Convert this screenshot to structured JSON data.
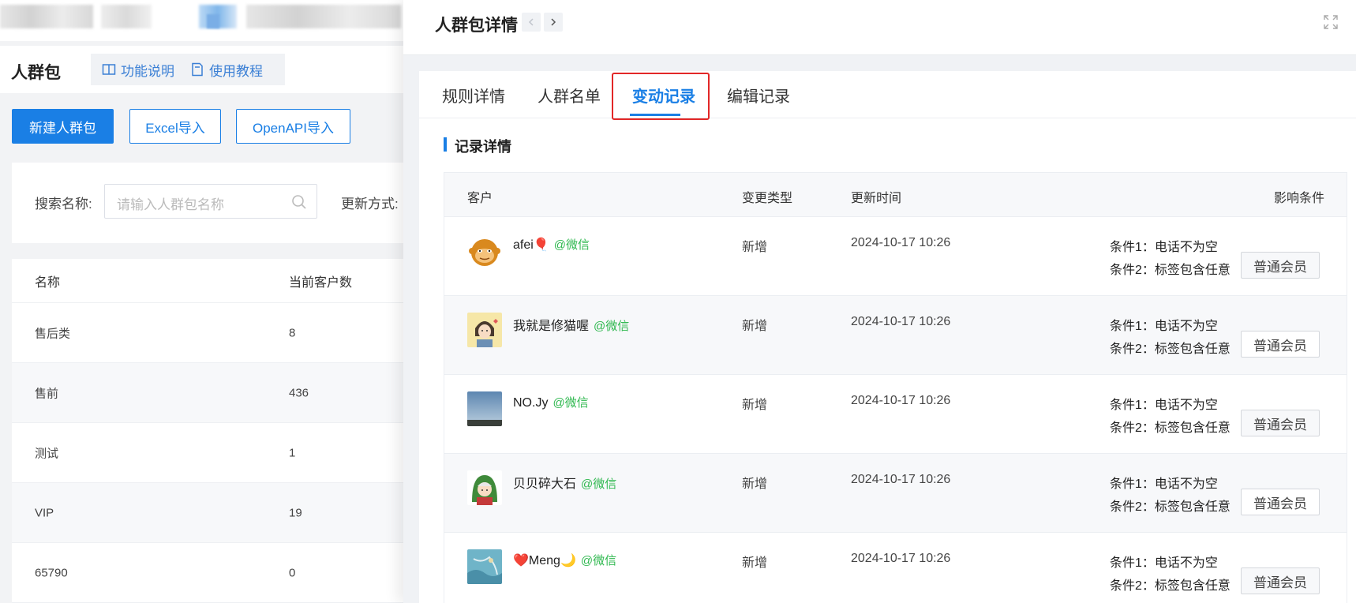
{
  "background": {
    "page_title": "人群包",
    "help_links": [
      "功能说明",
      "使用教程"
    ],
    "buttons": {
      "create": "新建人群包",
      "excel": "Excel导入",
      "openapi": "OpenAPI导入"
    },
    "search": {
      "label": "搜索名称:",
      "placeholder": "请输入人群包名称",
      "update_label": "更新方式:"
    },
    "table": {
      "headers": [
        "名称",
        "当前客户数"
      ],
      "rows": [
        {
          "name": "售后类",
          "count": "8"
        },
        {
          "name": "售前",
          "count": "436"
        },
        {
          "name": "测试",
          "count": "1"
        },
        {
          "name": "VIP",
          "count": "19"
        },
        {
          "name": "65790",
          "count": "0"
        }
      ]
    }
  },
  "drawer": {
    "title": "人群包详情",
    "tabs": [
      "规则详情",
      "人群名单",
      "变动记录",
      "编辑记录"
    ],
    "active_tab": "变动记录",
    "section_title": "记录详情",
    "columns": {
      "customer": "客户",
      "change_type": "变更类型",
      "update_time": "更新时间",
      "conditions": "影响条件"
    },
    "records": [
      {
        "name": "afei🎈",
        "channel": "@微信",
        "type": "新增",
        "time": "2024-10-17 10:26",
        "cond1": "条件1：电话不为空",
        "cond2": "条件2：标签包含任意",
        "tag": "普通会员",
        "avatar": "monkey-avatar"
      },
      {
        "name": "我就是修猫喔",
        "channel": "@微信",
        "type": "新增",
        "time": "2024-10-17 10:26",
        "cond1": "条件1：电话不为空",
        "cond2": "条件2：标签包含任意",
        "tag": "普通会员",
        "avatar": "anime-girl-avatar"
      },
      {
        "name": "NO.Jy",
        "channel": "@微信",
        "type": "新增",
        "time": "2024-10-17 10:26",
        "cond1": "条件1：电话不为空",
        "cond2": "条件2：标签包含任意",
        "tag": "普通会员",
        "avatar": "sky-avatar"
      },
      {
        "name": "贝贝碎大石",
        "channel": "@微信",
        "type": "新增",
        "time": "2024-10-17 10:26",
        "cond1": "条件1：电话不为空",
        "cond2": "条件2：标签包含任意",
        "tag": "普通会员",
        "avatar": "green-hood-avatar"
      },
      {
        "name": "❤️Meng🌙",
        "channel": "@微信",
        "type": "新增",
        "time": "2024-10-17 10:26",
        "cond1": "条件1：电话不为空",
        "cond2": "条件2：标签包含任意",
        "tag": "普通会员",
        "avatar": "sea-avatar"
      }
    ]
  },
  "colors": {
    "accent": "#1a7fe5",
    "wechat": "#2fb84f",
    "highlight_box": "#e22727"
  }
}
